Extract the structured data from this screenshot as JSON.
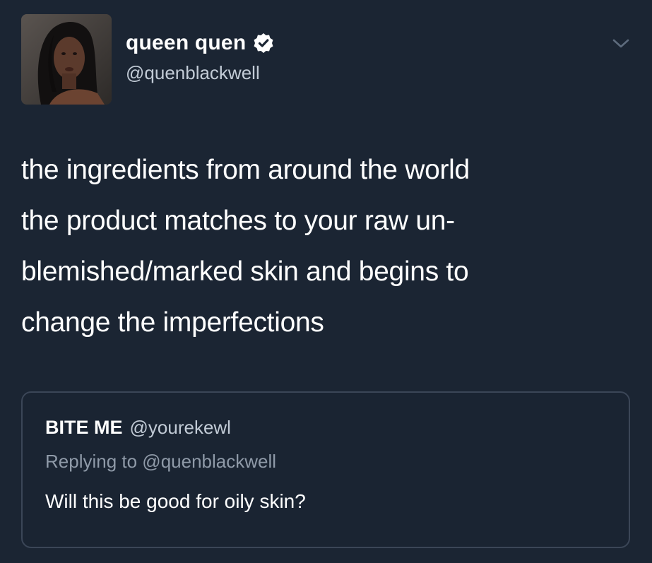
{
  "author": {
    "display_name": "queen quen",
    "handle": "@quenblackwell",
    "verified": true,
    "avatar": "profile-photo"
  },
  "tweet": {
    "text": "the ingredients from around the world\nthe product matches to your raw un-\nblemished/marked skin and begins to\nchange the imperfections"
  },
  "menu_icon": "chevron-down-icon",
  "quoted_tweet": {
    "display_name": "BITE ME",
    "handle": "@yourekewl",
    "replying_to": "Replying to @quenblackwell",
    "text": "Will this be good for oily skin?"
  },
  "colors": {
    "background": "#1b2533",
    "text": "#ffffff",
    "secondary_text": "#c2cbd6",
    "muted_text": "#8f9aa8",
    "quote_border": "#3b4657"
  }
}
